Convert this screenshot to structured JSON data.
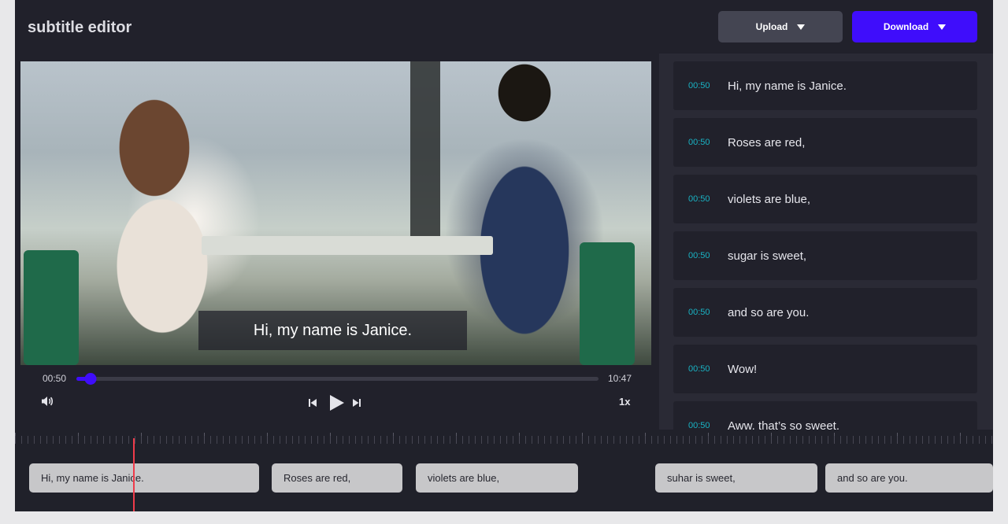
{
  "app": {
    "title": "subtitle editor"
  },
  "header": {
    "upload_label": "Upload",
    "download_label": "Download"
  },
  "player": {
    "current_time": "00:50",
    "total_time": "10:47",
    "progress_fraction": 0.027,
    "speed": "1x",
    "overlay_subtitle": "Hi, my name is Janice."
  },
  "subtitles": [
    {
      "time": "00:50",
      "text": "Hi, my name is Janice."
    },
    {
      "time": "00:50",
      "text": "Roses are red,"
    },
    {
      "time": "00:50",
      "text": "violets are blue,"
    },
    {
      "time": "00:50",
      "text": "sugar is sweet,"
    },
    {
      "time": "00:50",
      "text": "and so are you."
    },
    {
      "time": "00:50",
      "text": "Wow!"
    },
    {
      "time": "00:50",
      "text": "Aww, that’s so sweet."
    }
  ],
  "timeline": {
    "clips": [
      {
        "text": "Hi, my name is Janice."
      },
      {
        "text": "Roses are red,"
      },
      {
        "text": "violets are blue,"
      },
      {
        "text": "suhar is sweet,"
      },
      {
        "text": "and so are you."
      }
    ]
  },
  "colors": {
    "accent": "#3f0dfb",
    "timestamp": "#19b3c4",
    "playhead": "#ef3b4a",
    "panel": "#21212b",
    "background": "#2a2a35"
  },
  "icons": {
    "upload_caret": "caret-down-icon",
    "download_caret": "caret-down-icon",
    "volume": "volume-icon",
    "prev": "skip-previous-icon",
    "play": "play-icon",
    "next": "skip-next-icon"
  }
}
